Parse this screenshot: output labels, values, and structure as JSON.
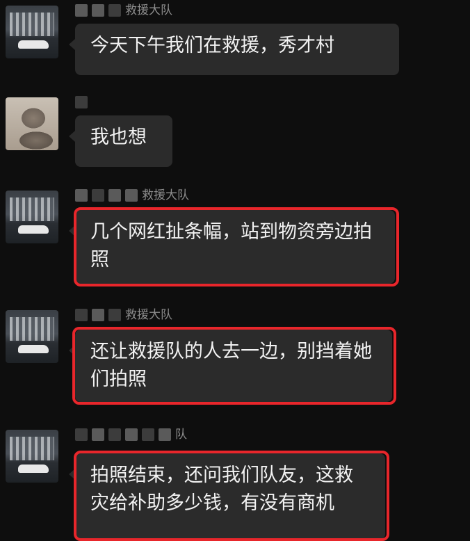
{
  "messages": [
    {
      "sender": "救援大队",
      "text": "今天下午我们在救援，秀才村"
    },
    {
      "sender": "",
      "text": "我也想"
    },
    {
      "sender": "救援大队",
      "text": "几个网红扯条幅，站到物资旁边拍照"
    },
    {
      "sender": "救援大队",
      "text": "还让救援队的人去一边，别挡着她们拍照"
    },
    {
      "sender": "队",
      "text": "拍照结束，还问我们队友，这救灾给补助多少钱，有没有商机"
    }
  ],
  "colors": {
    "background": "#0e0e0e",
    "bubble": "#2b2b2b",
    "highlight": "#e8262b"
  }
}
